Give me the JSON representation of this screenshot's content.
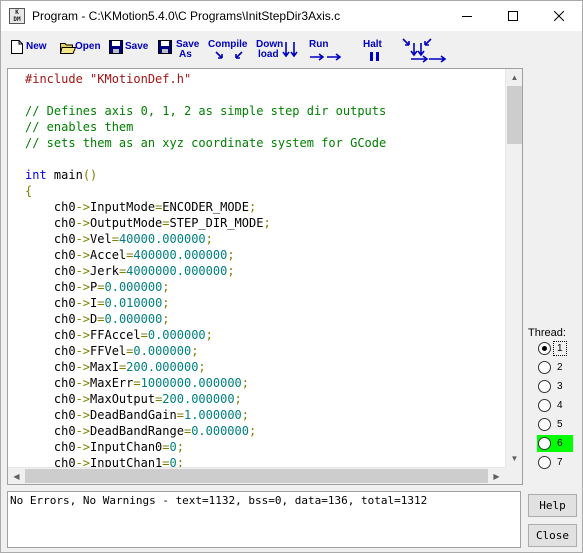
{
  "window": {
    "title": "Program - C:\\KMotion5.4.0\\C Programs\\InitStepDir3Axis.c",
    "app_icon": "KMotion-app-icon",
    "app_icon_text": "K\nDM"
  },
  "toolbar": {
    "new_label": "New",
    "open_label": "Open",
    "save_label": "Save",
    "save_as_label_1": "Save",
    "save_as_label_2": "As",
    "compile_label": "Compile",
    "download_label_1": "Down",
    "download_label_2": "load",
    "run_label": "Run",
    "halt_label": "Halt",
    "label_color": "#0000c0"
  },
  "code_lines": [
    [
      {
        "t": "#include \"KMotionDef.h\"",
        "c": "#a31515"
      }
    ],
    [],
    [
      {
        "t": "// Defines axis 0, 1, 2 as simple step dir outputs",
        "c": "#008000"
      }
    ],
    [
      {
        "t": "// enables them",
        "c": "#008000"
      }
    ],
    [
      {
        "t": "// sets them as an xyz coordinate system for GCode",
        "c": "#008000"
      }
    ],
    [],
    [
      {
        "t": "int",
        "c": "#0000ff"
      },
      {
        "t": " main",
        "c": "#000000"
      },
      {
        "t": "()",
        "c": "#808000"
      }
    ],
    [
      {
        "t": "{",
        "c": "#808000"
      }
    ],
    [
      {
        "t": "    ch0",
        "c": "#000000"
      },
      {
        "t": "->",
        "c": "#808000"
      },
      {
        "t": "InputMode",
        "c": "#000000"
      },
      {
        "t": "=",
        "c": "#808000"
      },
      {
        "t": "ENCODER_MODE",
        "c": "#000000"
      },
      {
        "t": ";",
        "c": "#808000"
      }
    ],
    [
      {
        "t": "    ch0",
        "c": "#000000"
      },
      {
        "t": "->",
        "c": "#808000"
      },
      {
        "t": "OutputMode",
        "c": "#000000"
      },
      {
        "t": "=",
        "c": "#808000"
      },
      {
        "t": "STEP_DIR_MODE",
        "c": "#000000"
      },
      {
        "t": ";",
        "c": "#808000"
      }
    ],
    [
      {
        "t": "    ch0",
        "c": "#000000"
      },
      {
        "t": "->",
        "c": "#808000"
      },
      {
        "t": "Vel",
        "c": "#000000"
      },
      {
        "t": "=",
        "c": "#808000"
      },
      {
        "t": "40000.000000",
        "c": "#008080"
      },
      {
        "t": ";",
        "c": "#808000"
      }
    ],
    [
      {
        "t": "    ch0",
        "c": "#000000"
      },
      {
        "t": "->",
        "c": "#808000"
      },
      {
        "t": "Accel",
        "c": "#000000"
      },
      {
        "t": "=",
        "c": "#808000"
      },
      {
        "t": "400000.000000",
        "c": "#008080"
      },
      {
        "t": ";",
        "c": "#808000"
      }
    ],
    [
      {
        "t": "    ch0",
        "c": "#000000"
      },
      {
        "t": "->",
        "c": "#808000"
      },
      {
        "t": "Jerk",
        "c": "#000000"
      },
      {
        "t": "=",
        "c": "#808000"
      },
      {
        "t": "4000000.000000",
        "c": "#008080"
      },
      {
        "t": ";",
        "c": "#808000"
      }
    ],
    [
      {
        "t": "    ch0",
        "c": "#000000"
      },
      {
        "t": "->",
        "c": "#808000"
      },
      {
        "t": "P",
        "c": "#000000"
      },
      {
        "t": "=",
        "c": "#808000"
      },
      {
        "t": "0.000000",
        "c": "#008080"
      },
      {
        "t": ";",
        "c": "#808000"
      }
    ],
    [
      {
        "t": "    ch0",
        "c": "#000000"
      },
      {
        "t": "->",
        "c": "#808000"
      },
      {
        "t": "I",
        "c": "#000000"
      },
      {
        "t": "=",
        "c": "#808000"
      },
      {
        "t": "0.010000",
        "c": "#008080"
      },
      {
        "t": ";",
        "c": "#808000"
      }
    ],
    [
      {
        "t": "    ch0",
        "c": "#000000"
      },
      {
        "t": "->",
        "c": "#808000"
      },
      {
        "t": "D",
        "c": "#000000"
      },
      {
        "t": "=",
        "c": "#808000"
      },
      {
        "t": "0.000000",
        "c": "#008080"
      },
      {
        "t": ";",
        "c": "#808000"
      }
    ],
    [
      {
        "t": "    ch0",
        "c": "#000000"
      },
      {
        "t": "->",
        "c": "#808000"
      },
      {
        "t": "FFAccel",
        "c": "#000000"
      },
      {
        "t": "=",
        "c": "#808000"
      },
      {
        "t": "0.000000",
        "c": "#008080"
      },
      {
        "t": ";",
        "c": "#808000"
      }
    ],
    [
      {
        "t": "    ch0",
        "c": "#000000"
      },
      {
        "t": "->",
        "c": "#808000"
      },
      {
        "t": "FFVel",
        "c": "#000000"
      },
      {
        "t": "=",
        "c": "#808000"
      },
      {
        "t": "0.000000",
        "c": "#008080"
      },
      {
        "t": ";",
        "c": "#808000"
      }
    ],
    [
      {
        "t": "    ch0",
        "c": "#000000"
      },
      {
        "t": "->",
        "c": "#808000"
      },
      {
        "t": "MaxI",
        "c": "#000000"
      },
      {
        "t": "=",
        "c": "#808000"
      },
      {
        "t": "200.000000",
        "c": "#008080"
      },
      {
        "t": ";",
        "c": "#808000"
      }
    ],
    [
      {
        "t": "    ch0",
        "c": "#000000"
      },
      {
        "t": "->",
        "c": "#808000"
      },
      {
        "t": "MaxErr",
        "c": "#000000"
      },
      {
        "t": "=",
        "c": "#808000"
      },
      {
        "t": "1000000.000000",
        "c": "#008080"
      },
      {
        "t": ";",
        "c": "#808000"
      }
    ],
    [
      {
        "t": "    ch0",
        "c": "#000000"
      },
      {
        "t": "->",
        "c": "#808000"
      },
      {
        "t": "MaxOutput",
        "c": "#000000"
      },
      {
        "t": "=",
        "c": "#808000"
      },
      {
        "t": "200.000000",
        "c": "#008080"
      },
      {
        "t": ";",
        "c": "#808000"
      }
    ],
    [
      {
        "t": "    ch0",
        "c": "#000000"
      },
      {
        "t": "->",
        "c": "#808000"
      },
      {
        "t": "DeadBandGain",
        "c": "#000000"
      },
      {
        "t": "=",
        "c": "#808000"
      },
      {
        "t": "1.000000",
        "c": "#008080"
      },
      {
        "t": ";",
        "c": "#808000"
      }
    ],
    [
      {
        "t": "    ch0",
        "c": "#000000"
      },
      {
        "t": "->",
        "c": "#808000"
      },
      {
        "t": "DeadBandRange",
        "c": "#000000"
      },
      {
        "t": "=",
        "c": "#808000"
      },
      {
        "t": "0.000000",
        "c": "#008080"
      },
      {
        "t": ";",
        "c": "#808000"
      }
    ],
    [
      {
        "t": "    ch0",
        "c": "#000000"
      },
      {
        "t": "->",
        "c": "#808000"
      },
      {
        "t": "InputChan0",
        "c": "#000000"
      },
      {
        "t": "=",
        "c": "#808000"
      },
      {
        "t": "0",
        "c": "#008080"
      },
      {
        "t": ";",
        "c": "#808000"
      }
    ],
    [
      {
        "t": "    ch0",
        "c": "#000000"
      },
      {
        "t": "->",
        "c": "#808000"
      },
      {
        "t": "InputChan1",
        "c": "#000000"
      },
      {
        "t": "=",
        "c": "#808000"
      },
      {
        "t": "0",
        "c": "#008080"
      },
      {
        "t": ";",
        "c": "#808000"
      }
    ]
  ],
  "threads": {
    "title": "Thread:",
    "items": [
      {
        "label": "1",
        "selected": true,
        "running": false
      },
      {
        "label": "2",
        "selected": false,
        "running": false
      },
      {
        "label": "3",
        "selected": false,
        "running": false
      },
      {
        "label": "4",
        "selected": false,
        "running": false
      },
      {
        "label": "5",
        "selected": false,
        "running": false
      },
      {
        "label": "6",
        "selected": false,
        "running": true
      },
      {
        "label": "7",
        "selected": false,
        "running": false
      }
    ],
    "running_color": "#00ff00"
  },
  "output": {
    "text": "No Errors, No Warnings - text=1132, bss=0, data=136, total=1312"
  },
  "buttons": {
    "help_label": "Help",
    "close_label": "Close"
  }
}
